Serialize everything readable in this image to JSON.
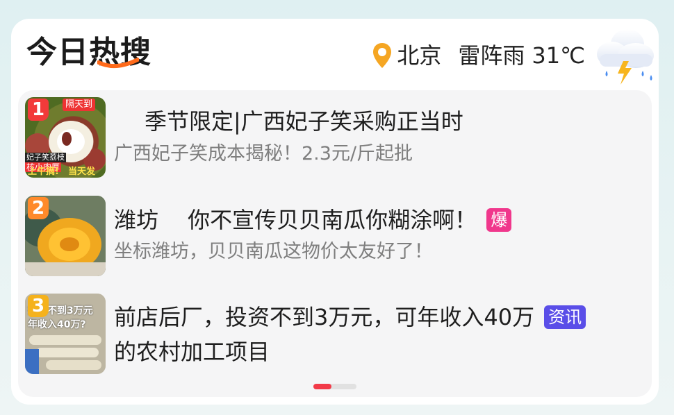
{
  "header": {
    "title_prefix": "今日",
    "title_hot": "热",
    "title_suffix": "搜",
    "location": "北京",
    "weather_condition": "雷阵雨",
    "temperature": "31℃"
  },
  "items": [
    {
      "rank": "1",
      "rank_color": "#f23a3a",
      "headline": "季节限定|广西妃子笑采购正当时",
      "subtitle": "广西妃子笑成本揭秘！2.3元/斤起批",
      "thumb_tag_top": "隔天到",
      "thumb_tag_mid1": "妃子笑荔枝",
      "thumb_tag_mid2": "核小肉厚",
      "thumb_tag_bot1": "上午摘!",
      "thumb_tag_bot2": "当天发"
    },
    {
      "rank": "2",
      "rank_color": "#ff8a2b",
      "headline": "潍坊　 你不宣传贝贝南瓜你糊涂啊！",
      "subtitle": "坐标潍坊，贝贝南瓜这物价太友好了！",
      "badge": "爆",
      "badge_color": "#f0378c"
    },
    {
      "rank": "3",
      "rank_color": "#f5b21c",
      "headline": "前店后厂，投资不到3万元，可年收入40万",
      "headline_cont": "的农村加工项目",
      "badge": "资讯",
      "badge_color": "#5a4ee8",
      "thumb_text1": "投资不到3万元",
      "thumb_text2": "年收入40万?"
    }
  ],
  "pager": {
    "total": 2,
    "active": 1
  }
}
